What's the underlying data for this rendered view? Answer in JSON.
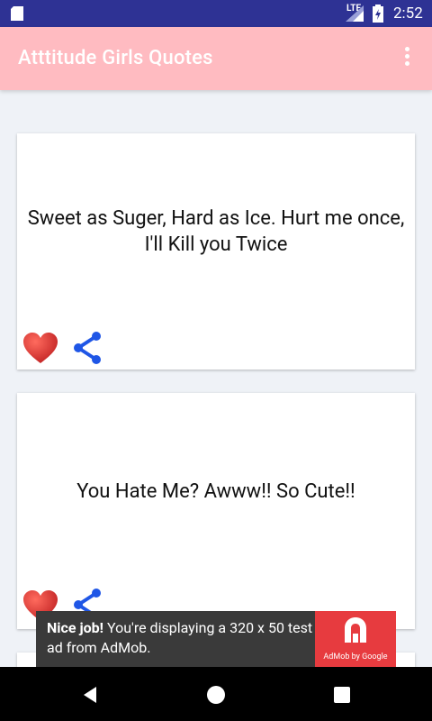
{
  "status_bar": {
    "network": "LTE",
    "time": "2:52"
  },
  "app_bar": {
    "title": "Atttitude Girls Quotes",
    "menu_icon": "more-vert-icon"
  },
  "cards": [
    {
      "quote": "Sweet as Suger, Hard as Ice. Hurt me once, I'll Kill you Twice",
      "like_icon": "heart-icon",
      "share_icon": "share-icon"
    },
    {
      "quote": "You Hate Me? Awww!! So Cute!!",
      "like_icon": "heart-icon",
      "share_icon": "share-icon"
    }
  ],
  "ad": {
    "headline": "Nice job!",
    "body": "You're displaying a 320 x 50 test ad from AdMob.",
    "badge_text": "AdMob by Google"
  },
  "nav_bar": {
    "back_icon": "back-icon",
    "home_icon": "home-icon",
    "recents_icon": "recents-icon"
  },
  "colors": {
    "status_bar": "#2e3294",
    "app_bar": "#ffbbc1",
    "background": "#eff2f7",
    "heart": "#e53935",
    "share": "#1f56e6",
    "ad_bg": "#3a3a3a",
    "ad_badge": "#e73b3f"
  }
}
